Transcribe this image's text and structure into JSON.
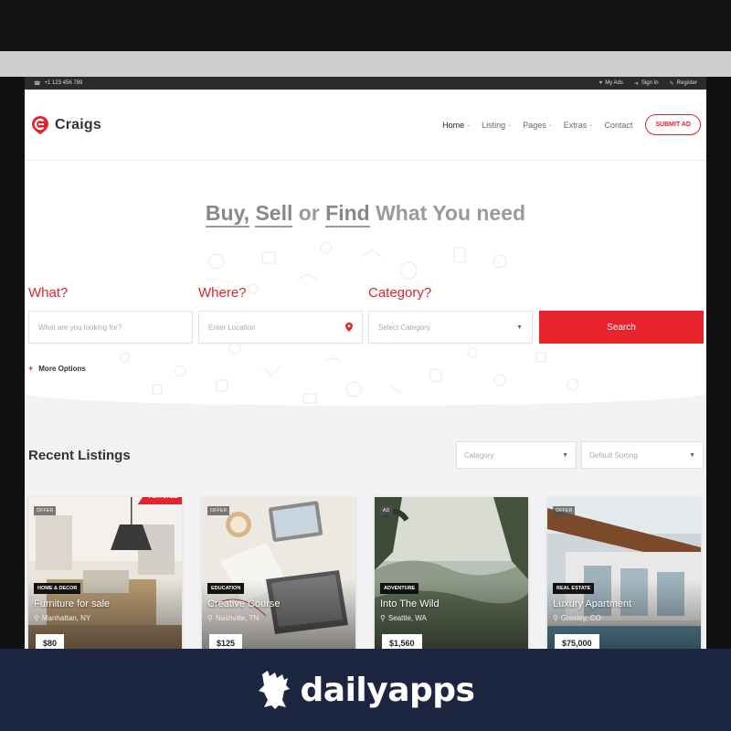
{
  "utility_bar": {
    "phone": "+1 123 456 789",
    "links": [
      "My Ads",
      "Sign In",
      "Register"
    ]
  },
  "header": {
    "brand": "Craigs",
    "nav": [
      {
        "label": "Home",
        "has_caret": true,
        "active": true
      },
      {
        "label": "Listing",
        "has_caret": true,
        "active": false
      },
      {
        "label": "Pages",
        "has_caret": true,
        "active": false
      },
      {
        "label": "Extras",
        "has_caret": true,
        "active": false
      },
      {
        "label": "Contact",
        "has_caret": false,
        "active": false
      }
    ],
    "submit_label": "SUBMIT AD"
  },
  "hero": {
    "title_parts": [
      "Buy,",
      "Sell",
      "or",
      "Find",
      "What You need"
    ]
  },
  "search": {
    "what_label": "What?",
    "where_label": "Where?",
    "category_label": "Category?",
    "what_placeholder": "What are you looking for?",
    "where_placeholder": "Enter Location",
    "category_value": "Select Category",
    "button_label": "Search",
    "more_options": "More Options"
  },
  "recent": {
    "title": "Recent Listings",
    "category_select": "Category",
    "sort_select": "Default Sorting"
  },
  "listings": [
    {
      "tag": "OFFER",
      "featured": "FEATURED",
      "category": "HOME & DECOR",
      "title": "Furniture for sale",
      "location": "Manhattan, NY",
      "price": "$80"
    },
    {
      "tag": "OFFER",
      "featured": "",
      "category": "EDUCATION",
      "title": "Creative Course",
      "location": "Nashville, TN",
      "price": "$125"
    },
    {
      "tag": "AD",
      "featured": "",
      "category": "ADVENTURE",
      "title": "Into The Wild",
      "location": "Seattle, WA",
      "price": "$1,560"
    },
    {
      "tag": "OFFER",
      "featured": "",
      "category": "REAL ESTATE",
      "title": "Luxury Apartment",
      "location": "Greeley, CO",
      "price": "$75,000"
    }
  ],
  "footer_banner": {
    "text": "dailyapps"
  },
  "colors": {
    "accent": "#e3232d",
    "banner": "#1c2640",
    "utility": "#2b2b2b"
  }
}
